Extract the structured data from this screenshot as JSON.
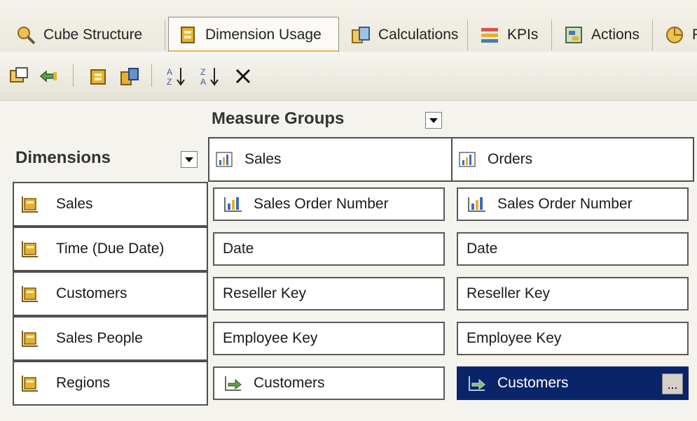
{
  "tabs": [
    {
      "label": "Cube Structure",
      "icon": "cube-structure-icon"
    },
    {
      "label": "Dimension Usage",
      "icon": "dimension-usage-icon",
      "active": true
    },
    {
      "label": "Calculations",
      "icon": "calculations-icon"
    },
    {
      "label": "KPIs",
      "icon": "kpis-icon"
    },
    {
      "label": "Actions",
      "icon": "actions-icon"
    },
    {
      "label": "P",
      "icon": "partitions-icon"
    }
  ],
  "toolbar": [
    "add-cube-dimension-icon",
    "define-relationship-icon",
    "show-all-dimensions-icon",
    "show-all-measure-groups-icon",
    "sort-ascending-icon",
    "sort-descending-icon",
    "delete-icon"
  ],
  "grid": {
    "measure_groups_title": "Measure Groups",
    "dimensions_title": "Dimensions",
    "measure_groups": [
      "Sales",
      "Orders"
    ],
    "dimensions": [
      "Sales",
      "Time (Due Date)",
      "Customers",
      "Sales People",
      "Regions"
    ],
    "relationships": [
      [
        "Sales Order Number",
        "Sales Order Number"
      ],
      [
        "Date",
        "Date"
      ],
      [
        "Reseller Key",
        "Reseller Key"
      ],
      [
        "Employee Key",
        "Employee Key"
      ],
      [
        "Customers",
        "Customers"
      ]
    ],
    "ellipsis": "..."
  },
  "colors": {
    "selection": "#0a246a",
    "grid_border": "#4f4f4f",
    "dimension_icon": "#e8b030"
  }
}
